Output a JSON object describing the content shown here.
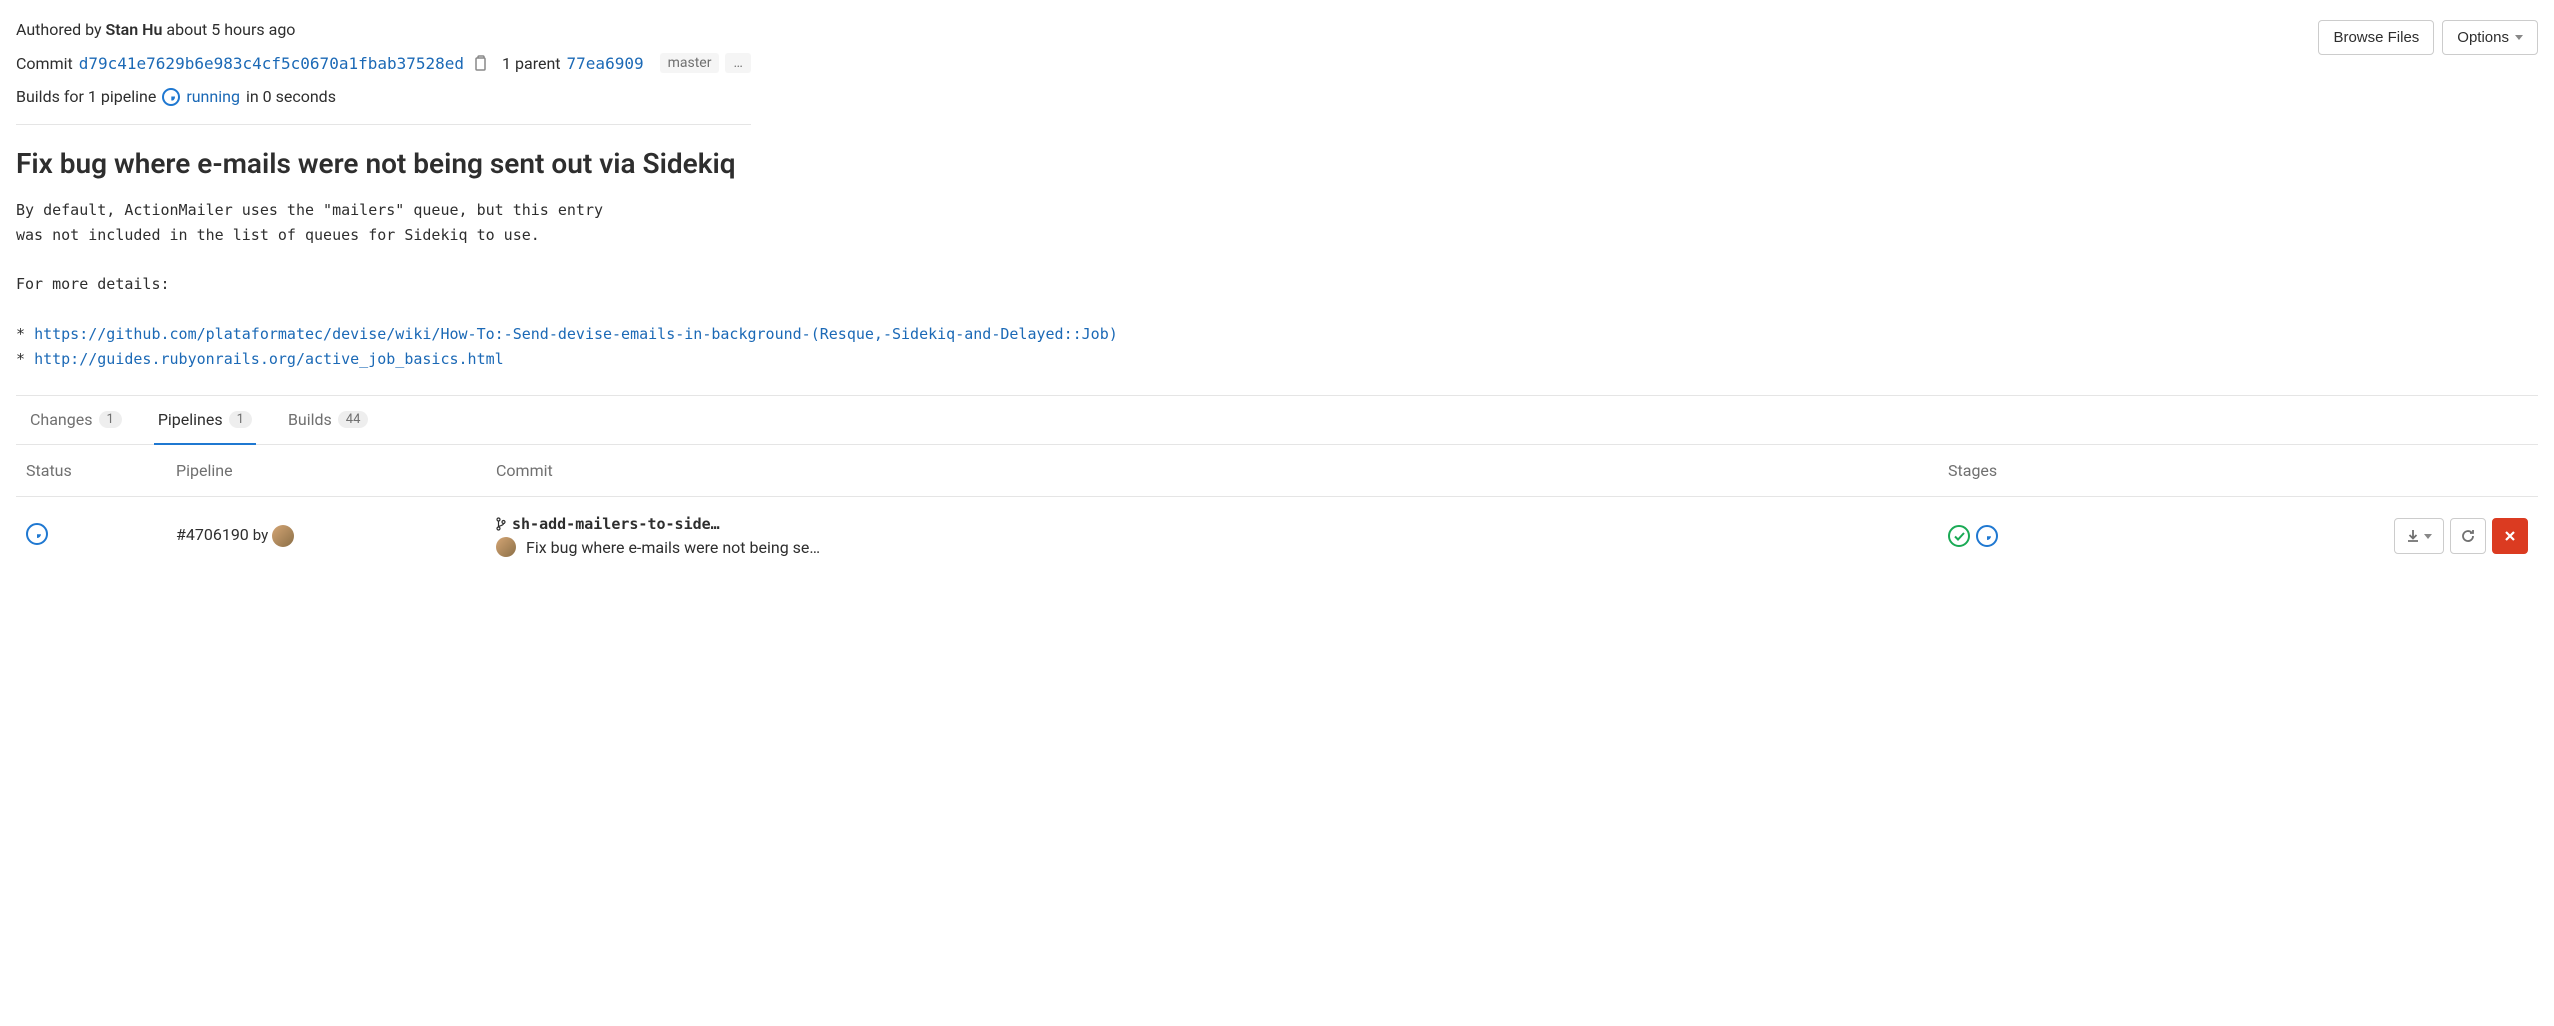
{
  "header": {
    "authored_prefix": "Authored by",
    "author_name": "Stan Hu",
    "authored_time": "about 5 hours ago",
    "browse_files": "Browse Files",
    "options": "Options"
  },
  "commit_meta": {
    "label": "Commit",
    "sha": "d79c41e7629b6e983c4cf5c0670a1fbab37528ed",
    "parent_label": "1 parent",
    "parent_sha": "77ea6909",
    "branch": "master",
    "ellipsis": "…"
  },
  "builds_line": {
    "prefix": "Builds for 1 pipeline",
    "status": "running",
    "suffix": "in 0 seconds"
  },
  "commit": {
    "title": "Fix bug where e-mails were not being sent out via Sidekiq",
    "desc_line1": "By default, ActionMailer uses the \"mailers\" queue, but this entry",
    "desc_line2": "was not included in the list of queues for Sidekiq to use.",
    "desc_line3": "For more details:",
    "link1": "https://github.com/plataformatec/devise/wiki/How-To:-Send-devise-emails-in-background-(Resque,-Sidekiq-and-Delayed::Job)",
    "link2": "http://guides.rubyonrails.org/active_job_basics.html"
  },
  "tabs": {
    "changes": {
      "label": "Changes",
      "count": "1"
    },
    "pipelines": {
      "label": "Pipelines",
      "count": "1"
    },
    "builds": {
      "label": "Builds",
      "count": "44"
    }
  },
  "table": {
    "headers": {
      "status": "Status",
      "pipeline": "Pipeline",
      "commit": "Commit",
      "stages": "Stages"
    },
    "row": {
      "pipeline_id": "#4706190",
      "by": "by",
      "branch": "sh-add-mailers-to-side…",
      "message": "Fix bug where e-mails were not being se…"
    }
  }
}
